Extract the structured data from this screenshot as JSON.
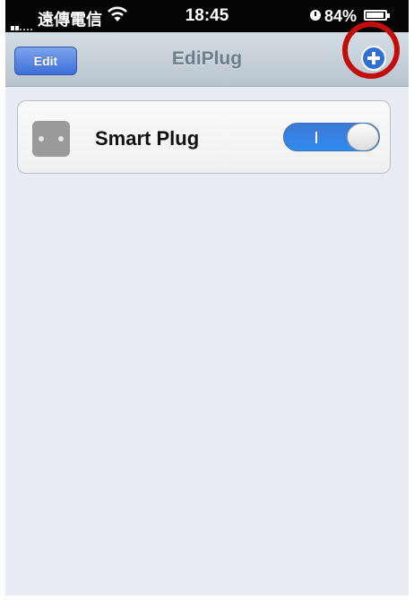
{
  "status_bar": {
    "carrier": "遠傳電信",
    "time": "18:45",
    "battery": "84%"
  },
  "nav": {
    "edit_label": "Edit",
    "title": "EdiPlug",
    "add_icon": "plus-circle-icon"
  },
  "devices": [
    {
      "name": "Smart Plug",
      "icon": "plug-icon",
      "switch_on": true
    }
  ],
  "colors": {
    "highlight_ring": "#c20d0d",
    "toggle_on": "#2f7ee8",
    "edit_button": "#4a7fe0"
  }
}
